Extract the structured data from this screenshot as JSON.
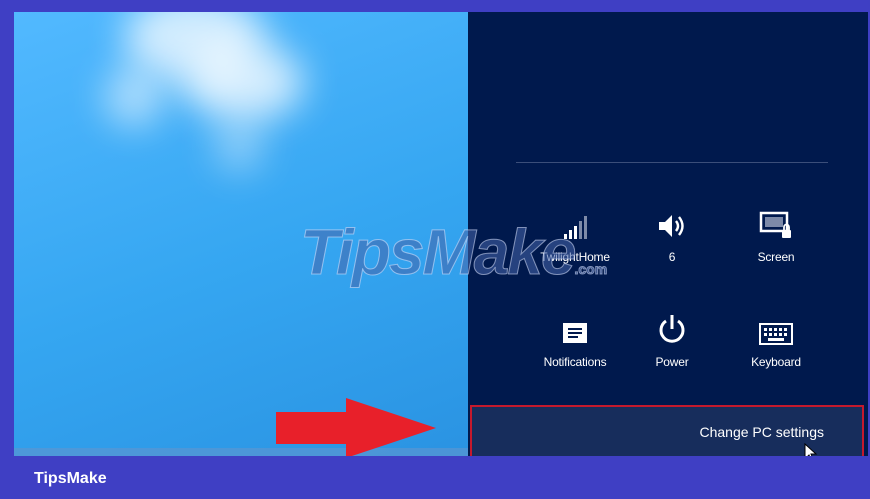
{
  "charms": {
    "tiles": [
      {
        "icon": "wifi-signal-icon",
        "label": "TwilightHome"
      },
      {
        "icon": "volume-icon",
        "label": "6"
      },
      {
        "icon": "screen-brightness-icon",
        "label": "Screen"
      },
      {
        "icon": "notifications-icon",
        "label": "Notifications"
      },
      {
        "icon": "power-icon",
        "label": "Power"
      },
      {
        "icon": "keyboard-icon",
        "label": "Keyboard"
      }
    ],
    "change_pc_settings": "Change PC settings"
  },
  "annotation": {
    "arrow_icon": "red-arrow-icon",
    "arrow_color": "#e8202a",
    "highlight_color": "#c5192d"
  },
  "watermark": {
    "main": "TipsMake",
    "suffix": ".com"
  },
  "footer": {
    "brand": "TipsMake"
  },
  "colors": {
    "frame_border": "#3f3fc4",
    "charms_bg": "#00194d",
    "desktop_bg": "#3aa9f3"
  }
}
